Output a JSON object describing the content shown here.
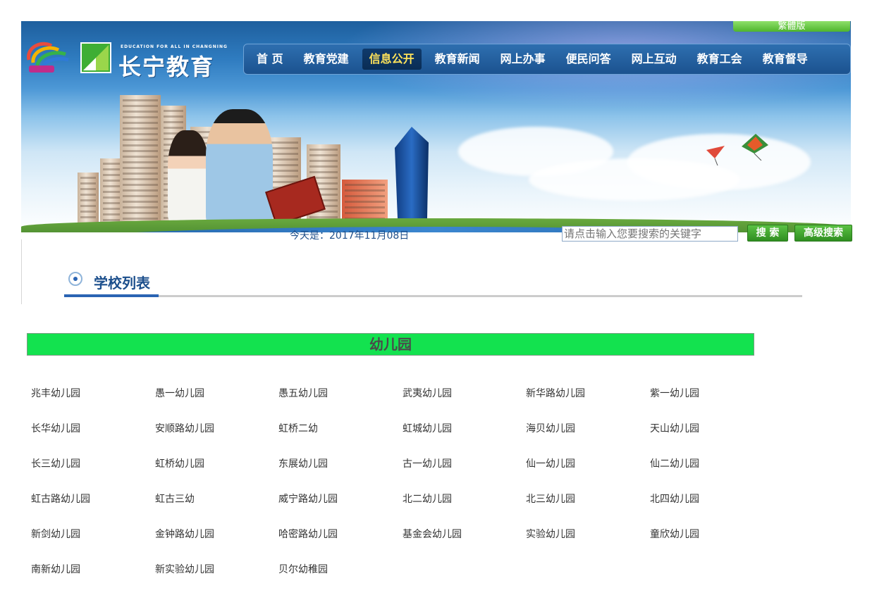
{
  "header": {
    "traditional_label": "繁體版",
    "logo_en": "EDUCATION FOR ALL IN CHANGNING",
    "logo_cn": "长宁教育",
    "nav": [
      {
        "label": "首 页",
        "active": false
      },
      {
        "label": "教育党建",
        "active": false
      },
      {
        "label": "信息公开",
        "active": true
      },
      {
        "label": "教育新闻",
        "active": false
      },
      {
        "label": "网上办事",
        "active": false
      },
      {
        "label": "便民问答",
        "active": false
      },
      {
        "label": "网上互动",
        "active": false
      },
      {
        "label": "教育工会",
        "active": false
      },
      {
        "label": "教育督导",
        "active": false
      }
    ]
  },
  "toolbar": {
    "date_text": "今天是：2017年11月08日",
    "search_placeholder": "请点击输入您要搜索的关键字",
    "search_label": "搜 索",
    "advanced_search_label": "高级搜索"
  },
  "section": {
    "title": "学校列表",
    "category": "幼儿园"
  },
  "schools": [
    [
      "兆丰幼儿园",
      "愚一幼儿园",
      "愚五幼儿园",
      "武夷幼儿园",
      "新华路幼儿园",
      "紫一幼儿园"
    ],
    [
      "长华幼儿园",
      "安顺路幼儿园",
      "虹桥二幼",
      "虹城幼儿园",
      "海贝幼儿园",
      "天山幼儿园"
    ],
    [
      "长三幼儿园",
      "虹桥幼儿园",
      "东展幼儿园",
      "古一幼儿园",
      "仙一幼儿园",
      "仙二幼儿园"
    ],
    [
      "虹古路幼儿园",
      "虹古三幼",
      "威宁路幼儿园",
      "北二幼儿园",
      "北三幼儿园",
      "北四幼儿园"
    ],
    [
      "新剑幼儿园",
      "金钟路幼儿园",
      "哈密路幼儿园",
      "基金会幼儿园",
      "实验幼儿园",
      "童欣幼儿园"
    ],
    [
      "南新幼儿园",
      "新实验幼儿园",
      "贝尔幼稚园"
    ]
  ],
  "colors": {
    "nav_active_text": "#ffe35a",
    "category_bar": "#13e24f",
    "section_title": "#1c4f8c"
  }
}
